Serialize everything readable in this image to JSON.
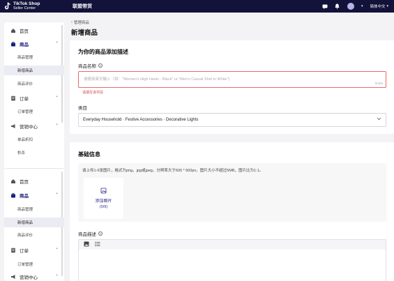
{
  "app": {
    "logo_line1": "TikTok Shop",
    "logo_line2": "Seller Center",
    "top_title": "联盟带货",
    "language": "简体中文",
    "colors": {
      "topbar": "#12123a",
      "accent": "#2a2a8a",
      "error": "#d64545"
    }
  },
  "sidebar": {
    "panel1": {
      "home": "首页",
      "products": "商品",
      "product_manage": "商品管理",
      "add_product": "新增商品",
      "product_review": "商品评价",
      "orders": "订单",
      "order_manage": "订单管理",
      "marketing": "营销中心",
      "single_discount": "单品折扣",
      "flash_sale": "秒杀"
    },
    "panel2": {
      "home": "首页",
      "products": "商品",
      "product_manage": "商品管理",
      "add_product": "新增商品",
      "product_review": "商品评价",
      "orders": "订单",
      "order_manage": "订单管理",
      "marketing": "营销中心"
    }
  },
  "main": {
    "breadcrumb": "管理商品",
    "page_title": "新增商品",
    "section1": {
      "title": "为你的商品添加描述",
      "name_label": "商品名称",
      "name_placeholder": "请使用英文输入（如：\"Women's High Heels - Black\" or \"Men's Casual Shirt in White\")",
      "name_counter": "0/255",
      "name_error": "请填写该字段",
      "category_label": "类目",
      "category_value": "Everyday Household · Festive Accessories · Decorative Lights"
    },
    "section2": {
      "title": "基础信息",
      "upload_hint": "请上传1-9张图片，格式为png，jpg或jpeg，分辨率大于600 * 600px，图片大小不超过5MB，图片比为1:1。",
      "upload_label": "添加图片",
      "upload_count": "(0/9)",
      "desc_label": "商品描述"
    }
  }
}
